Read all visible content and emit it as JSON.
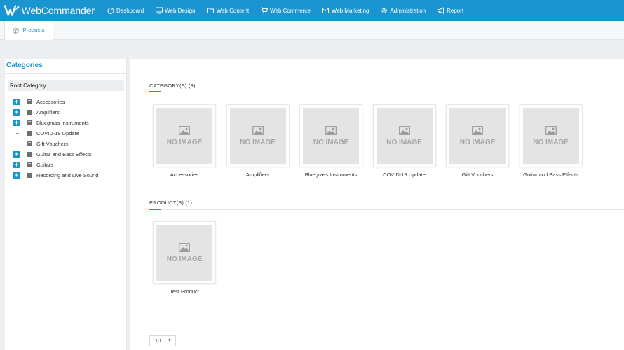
{
  "app": {
    "name": "WebCommander"
  },
  "nav": {
    "items": [
      {
        "label": "Dashboard",
        "icon": "dashboard-icon"
      },
      {
        "label": "Web Design",
        "icon": "monitor-icon"
      },
      {
        "label": "Web Content",
        "icon": "folder-icon"
      },
      {
        "label": "Web Commerce",
        "icon": "cart-icon"
      },
      {
        "label": "Web Marketing",
        "icon": "mail-icon"
      },
      {
        "label": "Administration",
        "icon": "gear-icon"
      },
      {
        "label": "Report",
        "icon": "megaphone-icon"
      }
    ]
  },
  "tabs": {
    "products": {
      "label": "Products",
      "icon": "box-icon"
    }
  },
  "sidebar": {
    "title": "Categories",
    "root": "Root Category",
    "tree": [
      {
        "label": "Accessories",
        "expandable": true
      },
      {
        "label": "Amplifiers",
        "expandable": true
      },
      {
        "label": "Bluegrass Instruments",
        "expandable": true
      },
      {
        "label": "COVID-19 Update",
        "expandable": false
      },
      {
        "label": "Gift Vouchers",
        "expandable": false
      },
      {
        "label": "Guitar and Bass Effects",
        "expandable": true
      },
      {
        "label": "Guitars",
        "expandable": true
      },
      {
        "label": "Recording and Live Sound",
        "expandable": true
      }
    ]
  },
  "main": {
    "categories_heading": "CATEGORY(S) (8)",
    "products_heading": "PRODUCT(S) (1)",
    "no_image_text": "NO IMAGE",
    "category_cards": [
      {
        "label": "Accessories"
      },
      {
        "label": "Amplifiers"
      },
      {
        "label": "Bluegrass Instruments"
      },
      {
        "label": "COVID-19 Update"
      },
      {
        "label": "Gift Vouchers"
      },
      {
        "label": "Guitar and Bass Effects"
      }
    ],
    "product_cards": [
      {
        "label": "Test Product"
      }
    ],
    "per_page": "10"
  },
  "colors": {
    "brand": "#1b95cf",
    "noimage_bg": "#e4e4e4",
    "noimage_text": "#a7a7a7"
  }
}
